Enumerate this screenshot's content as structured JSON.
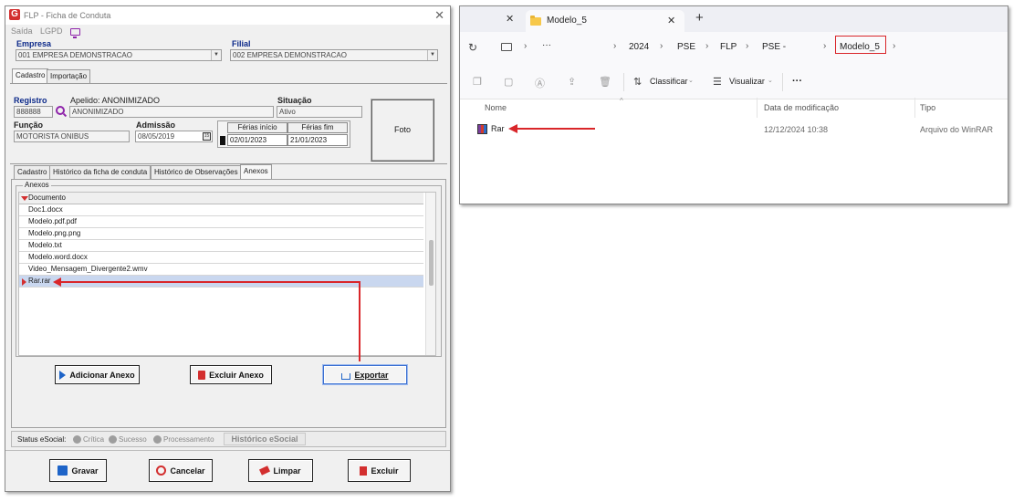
{
  "left_window": {
    "title": "FLP - Ficha de Conduta",
    "logo_letter": "G",
    "menu": {
      "saida": "Saída",
      "lgpd": "LGPD"
    },
    "empresa": {
      "label": "Empresa",
      "value": "001 EMPRESA DEMONSTRACAO"
    },
    "filial": {
      "label": "Filial",
      "value": "002 EMPRESA DEMONSTRACAO"
    },
    "top_tabs": [
      "Cadastro",
      "Importação"
    ],
    "registro": {
      "label": "Registro",
      "value": "888888"
    },
    "apelido": {
      "label": "Apelido: ANONIMIZADO",
      "value": "ANONIMIZADO"
    },
    "situacao": {
      "label": "Situação",
      "value": "Ativo"
    },
    "funcao": {
      "label": "Função",
      "value": "MOTORISTA ONIBUS"
    },
    "admissao": {
      "label": "Admissão",
      "value": "08/05/2019"
    },
    "ferias": {
      "inicio_label": "Férias início",
      "fim_label": "Férias fim",
      "inicio": "02/01/2023",
      "fim": "21/01/2023"
    },
    "foto_label": "Foto",
    "inner_tabs": [
      "Cadastro",
      "Histórico da ficha de conduta",
      "Histórico de Observações",
      "Anexos"
    ],
    "anexos": {
      "group_label": "Anexos",
      "column_header": "Documento",
      "rows": [
        "Doc1.docx",
        "Modelo.pdf.pdf",
        "Modelo.png.png",
        "Modelo.txt",
        "Modelo.word.docx",
        "Video_Mensagem_Divergente2.wmv",
        "Rar.rar"
      ],
      "selected_row": "Rar.rar"
    },
    "buttons": {
      "adicionar": "Adicionar Anexo",
      "excluir_anexo": "Excluir Anexo",
      "exportar": "Exportar"
    },
    "esocial": {
      "status_label": "Status eSocial:",
      "critica": "Crítica",
      "sucesso": "Sucesso",
      "processamento": "Processamento",
      "historico": "Histórico eSocial"
    },
    "footer_buttons": {
      "gravar": "Gravar",
      "cancelar": "Cancelar",
      "limpar": "Limpar",
      "excluir": "Excluir"
    }
  },
  "right_window": {
    "tab_title": "Modelo_5",
    "new_tab": "+",
    "breadcrumb": [
      "2024",
      "PSE",
      "FLP",
      "PSE -",
      "Modelo_5"
    ],
    "toolbar": {
      "sort": "Classificar",
      "view": "Visualizar",
      "more": "···"
    },
    "columns": {
      "name": "Nome",
      "date": "Data de modificação",
      "type": "Tipo"
    },
    "files": [
      {
        "name": "Rar",
        "date": "12/12/2024 10:38",
        "type": "Arquivo do WinRAR"
      }
    ]
  },
  "colors": {
    "accent_red": "#d9262a",
    "label_blue": "#0d2a8a",
    "selection": "#c9d7ef"
  }
}
